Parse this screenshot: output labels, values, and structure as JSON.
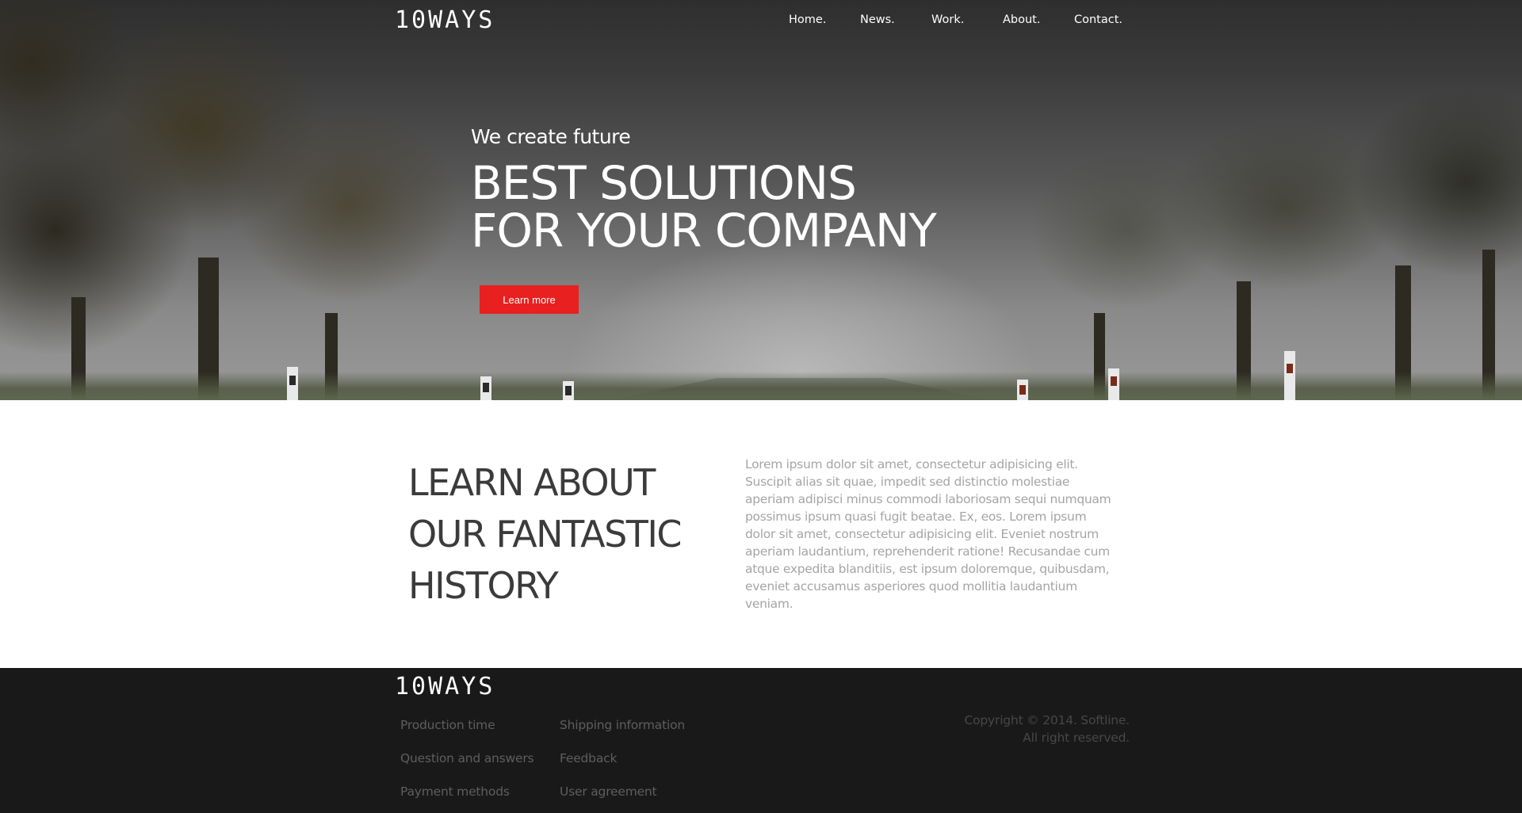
{
  "brand": {
    "logo_text": "10WAYS"
  },
  "nav": {
    "items": [
      {
        "label": "Home."
      },
      {
        "label": "News."
      },
      {
        "label": "Work."
      },
      {
        "label": "About."
      },
      {
        "label": "Contact."
      }
    ]
  },
  "hero": {
    "tagline": "We create future",
    "headline_line1": "BEST SOLUTIONS",
    "headline_line2": "FOR YOUR COMPANY",
    "cta_label": "Learn more",
    "cta_color": "#e8201f"
  },
  "about": {
    "heading_line1": "LEARN ABOUT",
    "heading_line2": "OUR FANTASTIC",
    "heading_line3": "HISTORY",
    "body": "Lorem ipsum dolor sit amet, consectetur adipisicing elit. Suscipit alias sit quae, impedit sed distinctio molestiae aperiam adipisci minus commodi laboriosam sequi numquam possimus ipsum quasi fugit beatae. Ex, eos. Lorem ipsum dolor sit amet, consectetur adipisicing elit. Eveniet nostrum aperiam laudantium, reprehenderit ratione! Recusandae cum atque expedita blanditiis, est ipsum doloremque, quibusdam, eveniet accusamus asperiores quod mollitia laudantium veniam."
  },
  "footer": {
    "logo_text": "10WAYS",
    "links_col1": [
      "Production time",
      "Question and answers",
      "Payment methods"
    ],
    "links_col2": [
      "Shipping information",
      "Feedback",
      "User agreement"
    ],
    "copyright_line1": "Copyright © 2014. Softline.",
    "copyright_line2": "All right reserved."
  }
}
